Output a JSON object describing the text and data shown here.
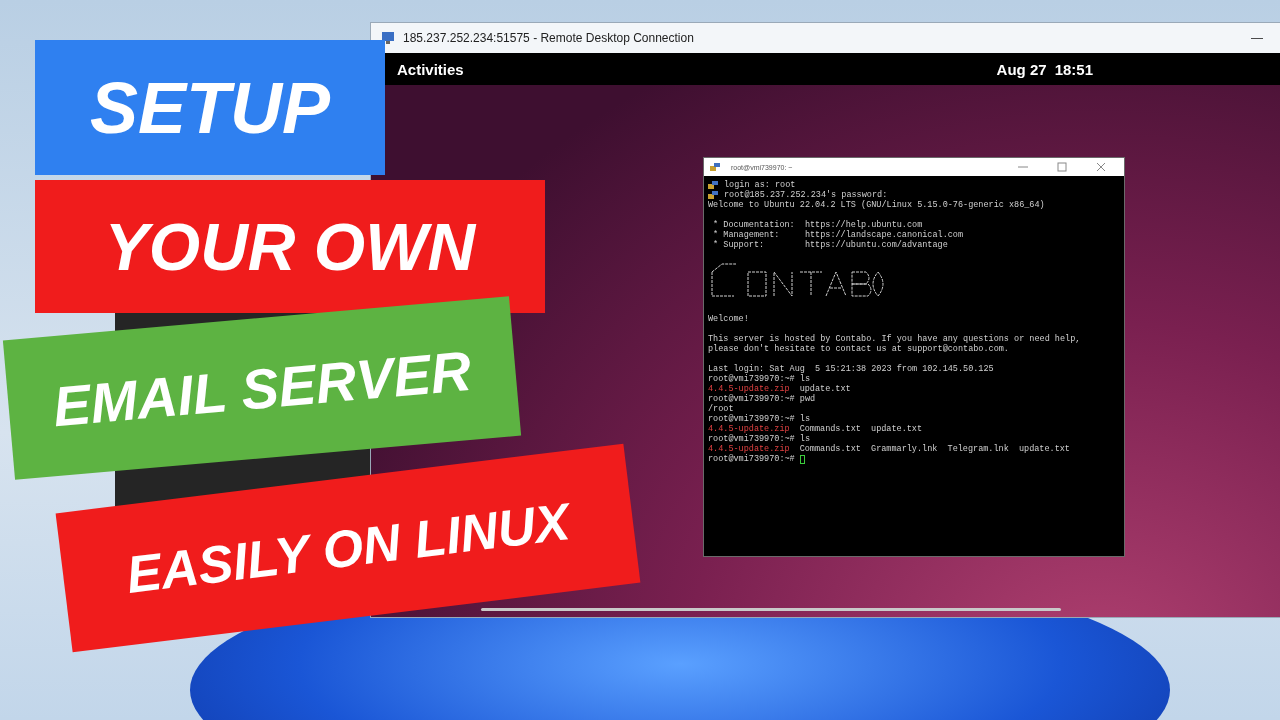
{
  "rdp_window": {
    "title": "185.237.252.234:51575 - Remote Desktop Connection",
    "minimize": "—"
  },
  "top_bar": {
    "activities": "Activities",
    "date": "Aug 27",
    "time": "18:51"
  },
  "terminal": {
    "title": "root@vmi739970: ~",
    "lines": [
      {
        "kind": "key",
        "segments": [
          {
            "kind": "plain",
            "text": "login as: root"
          }
        ]
      },
      {
        "kind": "key",
        "segments": [
          {
            "kind": "plain",
            "text": "root@185.237.252.234's password:"
          }
        ]
      },
      {
        "kind": "text",
        "segments": [
          {
            "kind": "plain",
            "text": "Welcome to Ubuntu 22.04.2 LTS (GNU/Linux 5.15.0-76-generic x86_64)"
          }
        ]
      },
      {
        "kind": "blank"
      },
      {
        "kind": "text",
        "segments": [
          {
            "kind": "plain",
            "text": " * Documentation:  https://help.ubuntu.com"
          }
        ]
      },
      {
        "kind": "text",
        "segments": [
          {
            "kind": "plain",
            "text": " * Management:     https://landscape.canonical.com"
          }
        ]
      },
      {
        "kind": "text",
        "segments": [
          {
            "kind": "plain",
            "text": " * Support:        https://ubuntu.com/advantage"
          }
        ]
      },
      {
        "kind": "blank"
      },
      {
        "kind": "art"
      },
      {
        "kind": "blank"
      },
      {
        "kind": "text",
        "segments": [
          {
            "kind": "plain",
            "text": "Welcome!"
          }
        ]
      },
      {
        "kind": "blank"
      },
      {
        "kind": "text",
        "segments": [
          {
            "kind": "plain",
            "text": "This server is hosted by Contabo. If you have any questions or need help,"
          }
        ]
      },
      {
        "kind": "text",
        "segments": [
          {
            "kind": "plain",
            "text": "please don't hesitate to contact us at support@contabo.com."
          }
        ]
      },
      {
        "kind": "blank"
      },
      {
        "kind": "text",
        "segments": [
          {
            "kind": "plain",
            "text": "Last login: Sat Aug  5 15:21:38 2023 from 102.145.50.125"
          }
        ]
      },
      {
        "kind": "text",
        "segments": [
          {
            "kind": "plain",
            "text": "root@vmi739970:~# ls"
          }
        ]
      },
      {
        "kind": "text",
        "segments": [
          {
            "kind": "archive",
            "text": "4.4.5-update.zip"
          },
          {
            "kind": "plain",
            "text": "update.txt"
          }
        ]
      },
      {
        "kind": "text",
        "segments": [
          {
            "kind": "plain",
            "text": "root@vmi739970:~# pwd"
          }
        ]
      },
      {
        "kind": "text",
        "segments": [
          {
            "kind": "plain",
            "text": "/root"
          }
        ]
      },
      {
        "kind": "text",
        "segments": [
          {
            "kind": "plain",
            "text": "root@vmi739970:~# ls"
          }
        ]
      },
      {
        "kind": "text",
        "segments": [
          {
            "kind": "archive",
            "text": "4.4.5-update.zip"
          },
          {
            "kind": "plain",
            "text": "Commands.txt  update.txt"
          }
        ]
      },
      {
        "kind": "text",
        "segments": [
          {
            "kind": "plain",
            "text": "root@vmi739970:~# ls"
          }
        ]
      },
      {
        "kind": "text",
        "segments": [
          {
            "kind": "archive",
            "text": "4.4.5-update.zip"
          },
          {
            "kind": "plain",
            "text": "Commands.txt  Grammarly.lnk  Telegram.lnk  update.txt"
          }
        ]
      },
      {
        "kind": "cursor",
        "segments": [
          {
            "kind": "plain",
            "text": "root@vmi739970:~#"
          }
        ]
      }
    ]
  },
  "banners": [
    {
      "text": "SETUP",
      "color": "#2f80f0"
    },
    {
      "text": "YOUR OWN",
      "color": "#f01c1c"
    },
    {
      "text": "EMAIL SERVER",
      "color": "#5db342"
    },
    {
      "text": "EASILY ON LINUX",
      "color": "#f01c1c"
    }
  ]
}
